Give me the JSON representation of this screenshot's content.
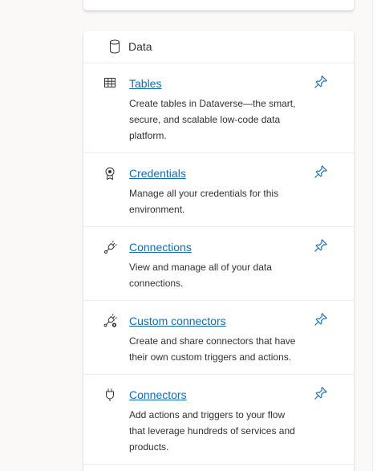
{
  "section": {
    "title": "Data",
    "icon": "database-icon"
  },
  "items": [
    {
      "label": "Tables",
      "description": "Create tables in Dataverse—the smart, secure, and scalable low-code data platform.",
      "icon": "table-grid-icon"
    },
    {
      "label": "Credentials",
      "description": "Manage all your credentials for this environment.",
      "icon": "ribbon-badge-icon"
    },
    {
      "label": "Connections",
      "description": "View and manage all of your data connections.",
      "icon": "plug-connection-icon"
    },
    {
      "label": "Custom connectors",
      "description": "Create and share connectors that have their own custom triggers and actions.",
      "icon": "plug-settings-icon"
    },
    {
      "label": "Connectors",
      "description": "Add actions and triggers to your flow that leverage hundreds of services and products.",
      "icon": "plug-icon"
    }
  ],
  "colors": {
    "link": "#0f6cbd",
    "pin": "#0f6cbd",
    "text": "#323130",
    "divider": "#edebe9"
  }
}
